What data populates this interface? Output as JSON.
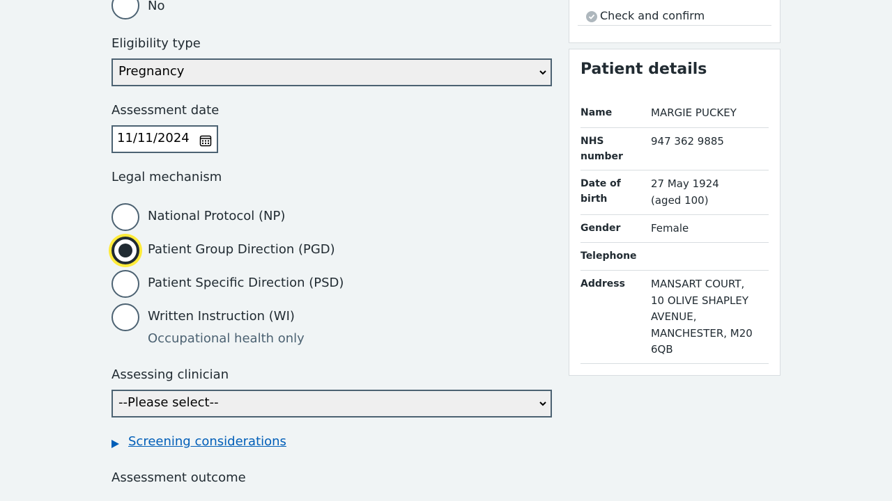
{
  "form": {
    "no_label": "No",
    "eligibility_label": "Eligibility type",
    "eligibility_value": "Pregnancy",
    "assessment_date_label": "Assessment date",
    "assessment_date_value": "11/11/2024",
    "legal_mechanism_label": "Legal mechanism",
    "legal_options": [
      {
        "label": "National Protocol (NP)",
        "checked": false
      },
      {
        "label": "Patient Group Direction (PGD)",
        "checked": true
      },
      {
        "label": "Patient Specific Direction (PSD)",
        "checked": false
      },
      {
        "label": "Written Instruction (WI)",
        "checked": false,
        "hint": "Occupational health only"
      }
    ],
    "assessing_clinician_label": "Assessing clinician",
    "assessing_clinician_value": "--Please select--",
    "screening_link": "Screening considerations",
    "assessment_outcome_label": "Assessment outcome"
  },
  "sidebar": {
    "nav_item": "Check and confirm",
    "patient": {
      "title": "Patient details",
      "rows": [
        {
          "key": "Name",
          "value": "MARGIE PUCKEY"
        },
        {
          "key": "NHS number",
          "value": "947 362 9885"
        },
        {
          "key": "Date of birth",
          "value": "27 May 1924 (aged 100)"
        },
        {
          "key": "Gender",
          "value": "Female"
        },
        {
          "key": "Telephone",
          "value": ""
        },
        {
          "key": "Address",
          "value": "MANSART COURT, 10 OLIVE SHAPLEY AVENUE, MANCHESTER, M20 6QB"
        }
      ]
    }
  },
  "colors": {
    "background": "#f0f4f5",
    "link": "#005eb8",
    "focus": "#ffeb3b",
    "text": "#212b32",
    "border": "#4c6272"
  }
}
